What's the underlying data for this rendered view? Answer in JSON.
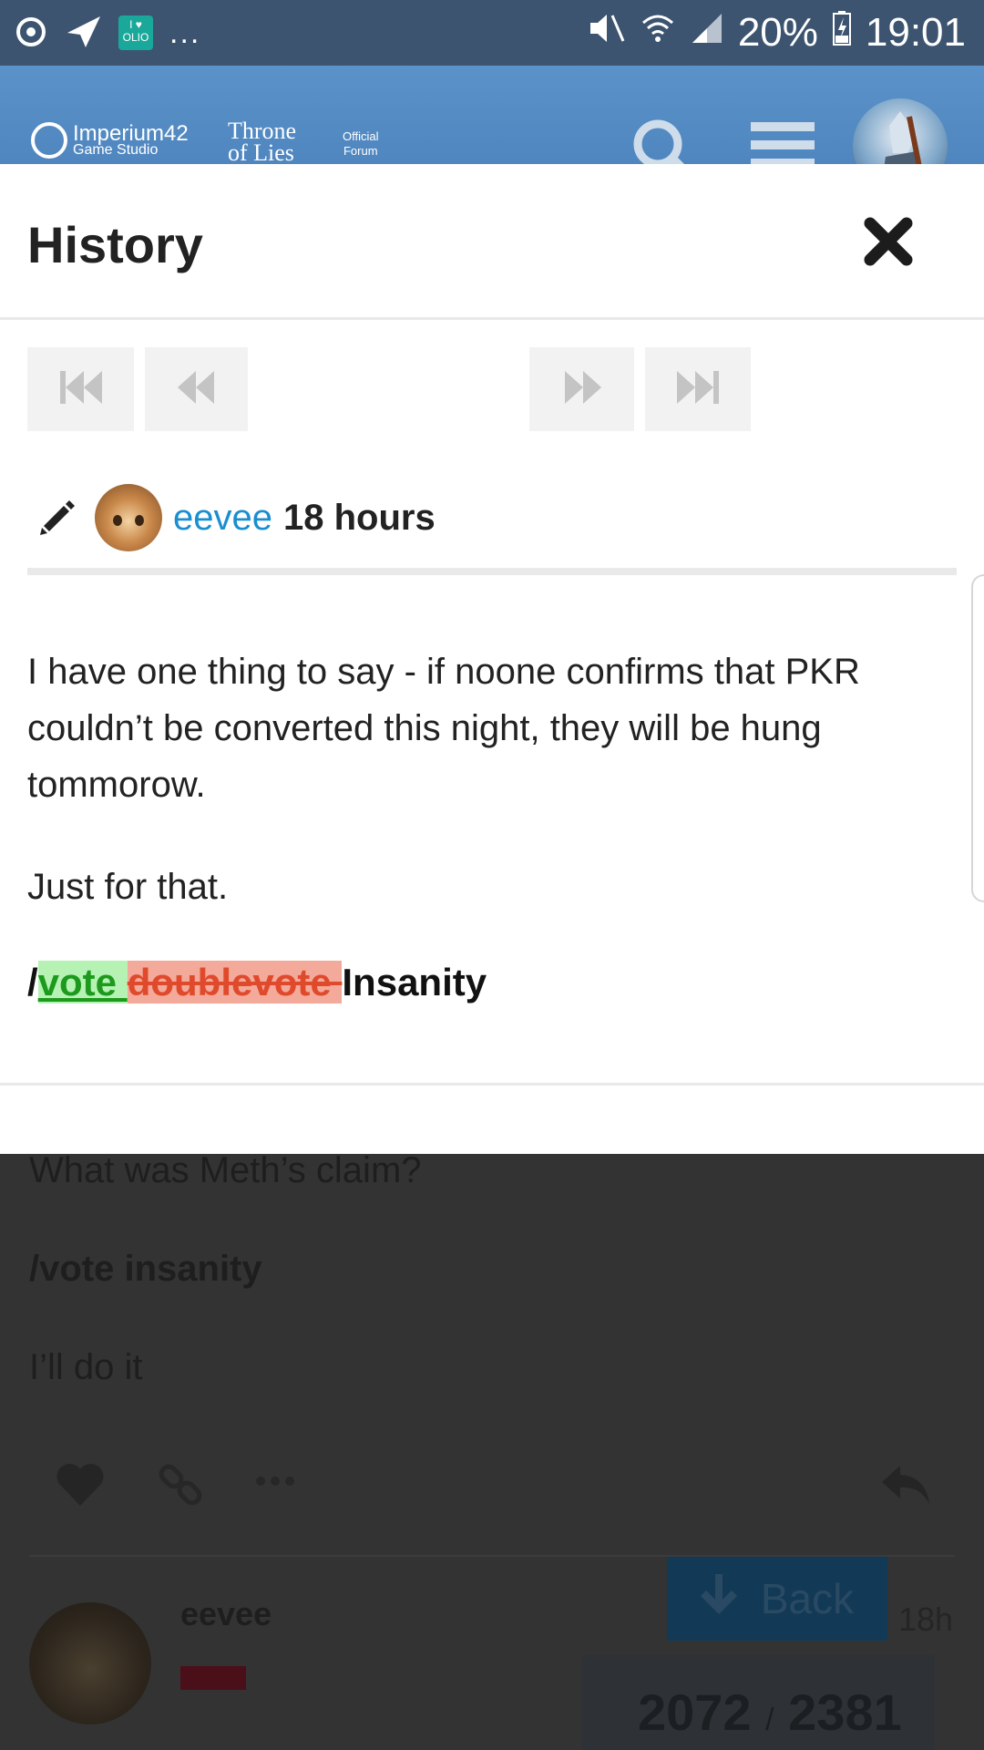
{
  "status_bar": {
    "battery": "20%",
    "time": "19:01",
    "olio_badge": "OLIO",
    "more": "..."
  },
  "site_header": {
    "logo_studio_line1": "Imperium42",
    "logo_studio_line2": "Game Studio",
    "logo_game_line1": "Throne",
    "logo_game_line2": "of Lies",
    "logo_forum_line1": "Official",
    "logo_forum_line2": "Forum"
  },
  "modal": {
    "title": "History",
    "revision": {
      "username": "eevee",
      "time": "18 hours"
    },
    "paragraph1": "I have one thing to say - if noone confirms that PKR couldn’t be converted this night, they will be hung tommorow.",
    "paragraph2": "Just for that.",
    "vote": {
      "prefix": "/",
      "inserted": "vote ",
      "deleted": "doublevote ",
      "suffix": "Insanity"
    }
  },
  "background": {
    "line1": "What was Meth’s claim?",
    "line2": "/vote insanity",
    "line3": "I’ll do it",
    "username": "eevee",
    "back_label": "Back",
    "post_age": "18h",
    "progress_current": "2072",
    "progress_separator": "/",
    "progress_total": "2381"
  },
  "colors": {
    "status_bar": "#3c5470",
    "header": "#5b92c9",
    "username_link": "#1a8fd0",
    "insert_bg": "#b6f2b3",
    "insert_text": "#1d9a1d",
    "delete_bg": "#f4aa9a",
    "delete_text": "#e04a2c"
  },
  "icons": [
    "power-icon",
    "send-icon",
    "mute-icon",
    "wifi-icon",
    "signal-icon",
    "battery-icon",
    "search-icon",
    "hamburger-menu-icon",
    "close-icon",
    "first-icon",
    "previous-icon",
    "next-icon",
    "last-icon",
    "pencil-icon",
    "heart-icon",
    "link-icon",
    "more-icon",
    "reply-icon",
    "arrow-down-icon"
  ]
}
